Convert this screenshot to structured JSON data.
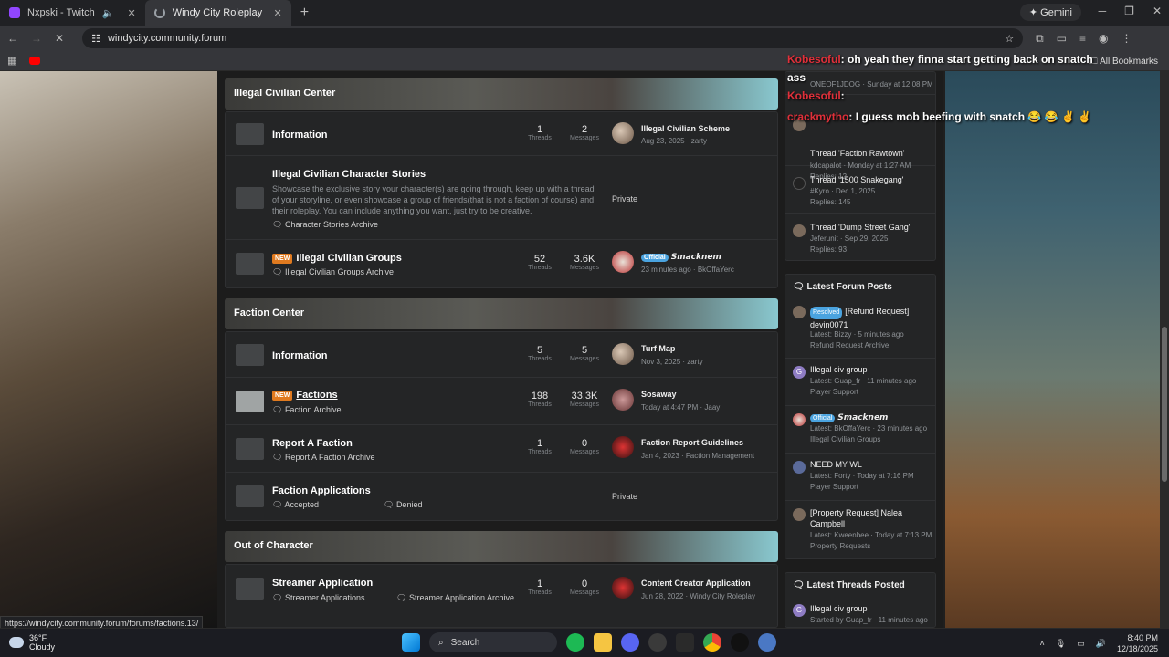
{
  "browser": {
    "tabs": [
      {
        "title": "Nxpski - Twitch",
        "active": false
      },
      {
        "title": "Windy City Roleplay",
        "active": true
      }
    ],
    "gemini_label": "Gemini",
    "url": "windycity.community.forum",
    "all_bookmarks": "All Bookmarks",
    "status_url": "https://windycity.community.forum/forums/factions.13/"
  },
  "stream_chat": [
    {
      "user": "Kobesoful",
      "text": ": oh yeah they finna start getting back on snatch"
    },
    {
      "user": "ass",
      "text": ""
    },
    {
      "user": "Kobesoful",
      "text": ":"
    },
    {
      "user": "crackmytho",
      "text": ": I guess mob beefing with snatch 😂 😂 ✌ ✌"
    }
  ],
  "categories": {
    "illegal": {
      "title": "Illegal Civilian Center",
      "rows": [
        {
          "title": "Information",
          "threads": "1",
          "messages": "2",
          "latest_title": "Illegal Civilian Scheme",
          "latest_meta": "Aug 23, 2025 · zarty"
        },
        {
          "title": "Illegal Civilian Character Stories",
          "desc": "Showcase the exclusive story your character(s) are going through, keep up with a thread of your storyline, or even showcase a group of friends(that is not a faction of course) and their roleplay. You can include anything you want, just try to be creative.",
          "sub": "Character Stories Archive",
          "private": "Private"
        },
        {
          "badge": "NEW",
          "title": "Illegal Civilian Groups",
          "sub": "Illegal Civilian Groups Archive",
          "threads": "52",
          "messages": "3.6K",
          "latest_badge": "Official",
          "latest_title": "𝙎𝙢𝙖𝙘𝙠𝙣𝙚𝙢",
          "latest_meta": "23 minutes ago · BkOffaYerc"
        }
      ]
    },
    "faction": {
      "title": "Faction Center",
      "rows": [
        {
          "title": "Information",
          "threads": "5",
          "messages": "5",
          "latest_title": "Turf Map",
          "latest_meta": "Nov 3, 2025 · zarty"
        },
        {
          "badge": "NEW",
          "title": "Factions",
          "sub": "Faction Archive",
          "threads": "198",
          "messages": "33.3K",
          "latest_title": "Sosaway",
          "latest_meta": "Today at 4:47 PM · Jaay"
        },
        {
          "title": "Report A Faction",
          "sub": "Report A Faction Archive",
          "threads": "1",
          "messages": "0",
          "latest_title": "Faction Report Guidelines",
          "latest_meta": "Jan 4, 2023 · Faction Management"
        },
        {
          "title": "Faction Applications",
          "sub": "Accepted",
          "sub2": "Denied",
          "private": "Private"
        }
      ]
    },
    "ooc": {
      "title": "Out of Character",
      "rows": [
        {
          "title": "Streamer Application",
          "sub": "Streamer Applications",
          "sub2": "Streamer Application Archive",
          "threads": "1",
          "messages": "0",
          "latest_title": "Content Creator Application",
          "latest_meta": "Jun 28, 2022 · Windy City Roleplay"
        }
      ]
    },
    "threads_label": "Threads",
    "messages_label": "Messages"
  },
  "sidebar": {
    "top_items": [
      {
        "title": "ONEOF1JDOG · Sunday at 12:08 PM",
        "meta": ""
      },
      {
        "title": "Thread 'Faction Rawtown'",
        "meta": "kdcapalot · Monday at 1:27 AM",
        "replies": "Replies: 12"
      },
      {
        "title": "Thread '1500 Snakegang'",
        "meta": "#Kyro · Dec 1, 2025",
        "replies": "Replies: 145"
      },
      {
        "title": "Thread 'Dump Street Gang'",
        "meta": "Jeferunit · Sep 29, 2025",
        "replies": "Replies: 93"
      }
    ],
    "latest_posts_title": "Latest Forum Posts",
    "latest_posts": [
      {
        "badge": "Resolved",
        "title": "[Refund Request] devin0071",
        "meta": "Latest: Bizzy · 5 minutes ago",
        "forum": "Refund Request Archive"
      },
      {
        "title": "Illegal civ group",
        "meta": "Latest: Guap_fr · 11 minutes ago",
        "forum": "Player Support",
        "letter": "G"
      },
      {
        "badge": "Official",
        "title": "𝙎𝙢𝙖𝙘𝙠𝙣𝙚𝙢",
        "meta": "Latest: BkOffaYerc · 23 minutes ago",
        "forum": "Illegal Civilian Groups"
      },
      {
        "title": "NEED MY WL",
        "meta": "Latest: Forty · Today at 7:16 PM",
        "forum": "Player Support"
      },
      {
        "title": "[Property Request] Nalea Campbell",
        "meta": "Latest: Kweenbee · Today at 7:13 PM",
        "forum": "Property Requests"
      }
    ],
    "latest_threads_title": "Latest Threads Posted",
    "latest_threads": [
      {
        "title": "Illegal civ group",
        "meta": "Started by Guap_fr · 11 minutes ago",
        "letter": "G"
      }
    ]
  },
  "taskbar": {
    "temp": "36°F",
    "weather": "Cloudy",
    "search": "Search",
    "time": "8:40 PM",
    "date": "12/18/2025"
  }
}
